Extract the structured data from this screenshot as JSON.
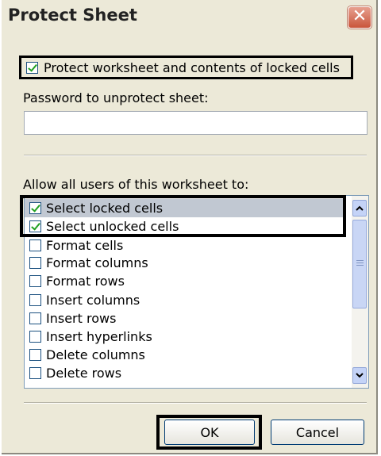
{
  "dialog": {
    "title": "Protect Sheet",
    "close_icon": "close-icon"
  },
  "protect_checkbox": {
    "label": "Protect worksheet and contents of locked cells",
    "checked": true
  },
  "password": {
    "label": "Password to unprotect sheet:",
    "value": ""
  },
  "allow": {
    "label": "Allow all users of this worksheet to:",
    "items": [
      {
        "label": "Select locked cells",
        "checked": true
      },
      {
        "label": "Select unlocked cells",
        "checked": true
      },
      {
        "label": "Format cells",
        "checked": false
      },
      {
        "label": "Format columns",
        "checked": false
      },
      {
        "label": "Format rows",
        "checked": false
      },
      {
        "label": "Insert columns",
        "checked": false
      },
      {
        "label": "Insert rows",
        "checked": false
      },
      {
        "label": "Insert hyperlinks",
        "checked": false
      },
      {
        "label": "Delete columns",
        "checked": false
      },
      {
        "label": "Delete rows",
        "checked": false
      }
    ]
  },
  "buttons": {
    "ok": "OK",
    "cancel": "Cancel"
  },
  "colors": {
    "dialog_bg": "#ece9d8",
    "check_green": "#21a121",
    "close_red": "#c9553b"
  }
}
